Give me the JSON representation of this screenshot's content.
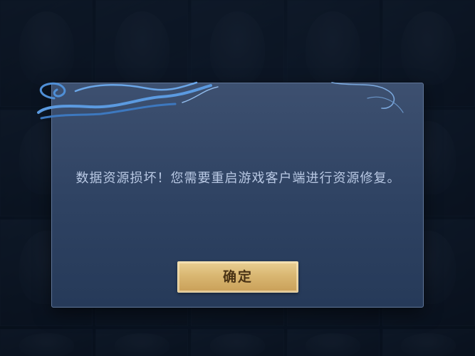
{
  "dialog": {
    "message": "数据资源损坏！您需要重启游戏客户端进行资源修复。",
    "confirm_label": "确定"
  },
  "colors": {
    "dialog_bg": "#34496a",
    "dialog_border": "#5f7597",
    "message_text": "#b9c9e4",
    "button_gold": "#d9b772",
    "button_text": "#4a3315"
  }
}
